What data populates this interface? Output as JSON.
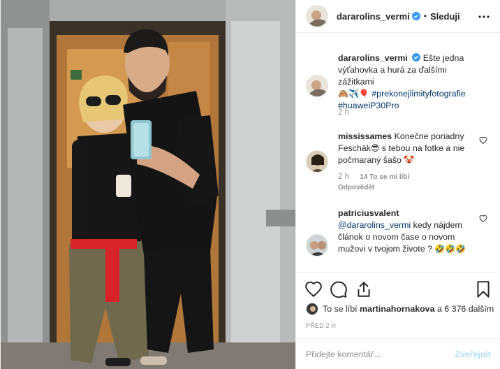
{
  "header": {
    "username": "dararolins_vermi",
    "separator": "•",
    "follow_label": "Sleduji"
  },
  "caption": {
    "username": "dararolins_vermi",
    "text": "Ešte jedna výťahovka a hurá za ďalšími zážitkami",
    "emojis": "🙈✈️🎈",
    "hashtag1": "#prekonejlimityfotografie",
    "hashtag2": "#huaweiP30Pro",
    "time": "2 h"
  },
  "comments": [
    {
      "username": "mississames",
      "text_before": "Konečne poriadny Feschák",
      "emoji1": "😎",
      "text_after": "s tebou na fotke a nie počmaraný šašo",
      "emoji2": "🤡",
      "time": "2 h",
      "likes": "14 To se mi líbí",
      "reply": "Odpovědět"
    },
    {
      "username": "patriciusvalent",
      "mention": "@dararolins_vermi",
      "text": "kedy nájdem článok o novom čase o novom mužovi v tvojom živote ?",
      "emojis": "🤣🤣🤣"
    }
  ],
  "likes": {
    "prefix": "To se líbí",
    "user": "martinahornakova",
    "suffix": "a 6 376 dalším"
  },
  "time_ago": "PŘED 2 H",
  "add_comment": {
    "placeholder": "Přidejte komentář...",
    "post_label": "Zveřejnit"
  },
  "colors": {
    "verified": "#3897f0",
    "link": "#003569",
    "post_button_disabled": "#b2dffc",
    "muted": "#8e8e8e"
  },
  "icons": [
    "verified-badge-icon",
    "more-options-icon",
    "heart-icon",
    "comment-icon",
    "share-icon",
    "bookmark-icon"
  ]
}
